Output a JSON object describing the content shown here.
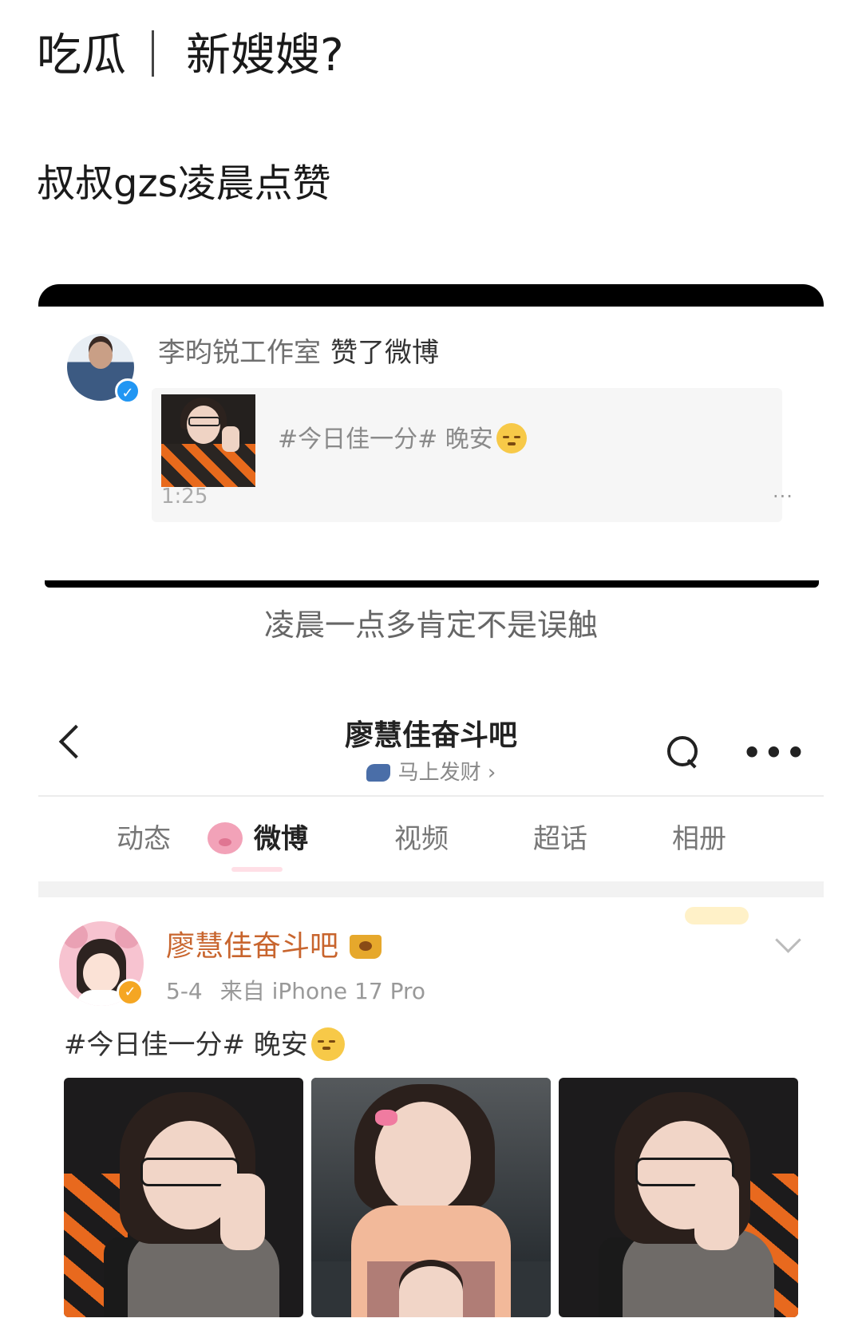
{
  "post": {
    "title_left": "吃瓜",
    "title_right": "新嫂嫂?",
    "subtitle": "叔叔gzs凌晨点赞"
  },
  "screenshot1": {
    "liker_name": "李昀锐工作室",
    "liker_action": "赞了微博",
    "quoted_text": "#今日佳一分# 晚安",
    "time": "1:25",
    "more": "···"
  },
  "caption": "凌晨一点多肯定不是误触",
  "profile": {
    "name": "廖慧佳奋斗吧",
    "subtitle": "马上发财 ›",
    "tabs": [
      "动态",
      "微博",
      "视频",
      "超话",
      "相册"
    ],
    "active_tab": "微博"
  },
  "post2": {
    "author": "廖慧佳奋斗吧",
    "date": "5-4",
    "source": "来自 iPhone 17 Pro",
    "content": "#今日佳一分# 晚安"
  },
  "icons": {
    "back": "chevron-left-icon",
    "search": "search-icon",
    "more": "more-horizontal-icon",
    "verified": "verified-badge-icon",
    "emoji": "sleepy-face-emoji"
  },
  "colors": {
    "accent_orange": "#c8652e",
    "verified_blue": "#2196f3",
    "verified_gold": "#f5a623"
  }
}
